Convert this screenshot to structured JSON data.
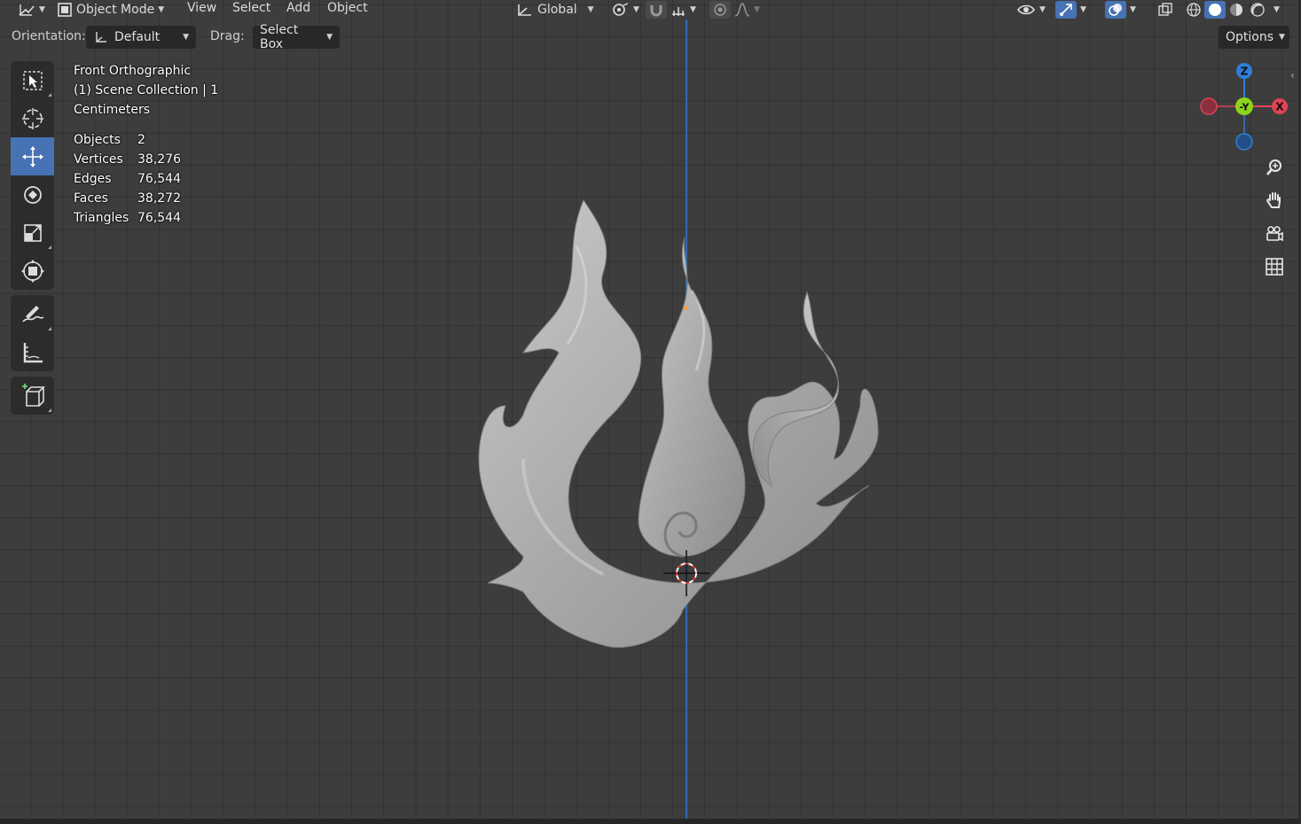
{
  "header": {
    "editor_type_icon": "editor-type-icon",
    "mode_label": "Object Mode",
    "menus": [
      "View",
      "Select",
      "Add",
      "Object"
    ],
    "transform_orientation": "Global",
    "colors": {
      "accent": "#4772b3",
      "background": "#3d3d3d",
      "header": "#303030"
    }
  },
  "tool_settings": {
    "orientation_label": "Orientation:",
    "orientation_value": "Default",
    "drag_label": "Drag:",
    "drag_value": "Select Box",
    "options_label": "Options"
  },
  "toolbar": {
    "tools": [
      {
        "name": "select-box-tool",
        "active": false
      },
      {
        "name": "cursor-tool",
        "active": false
      },
      {
        "name": "move-tool",
        "active": true
      },
      {
        "name": "rotate-tool",
        "active": false
      },
      {
        "name": "scale-tool",
        "active": false
      },
      {
        "name": "transform-tool",
        "active": false
      },
      {
        "name": "annotate-tool",
        "active": false
      },
      {
        "name": "measure-tool",
        "active": false
      },
      {
        "name": "add-cube-tool",
        "active": false
      }
    ]
  },
  "overlay": {
    "view_name": "Front Orthographic",
    "collection": "(1) Scene Collection | 1",
    "units": "Centimeters"
  },
  "stats": [
    {
      "label": "Objects",
      "value": "2"
    },
    {
      "label": "Vertices",
      "value": "38,276"
    },
    {
      "label": "Edges",
      "value": "76,544"
    },
    {
      "label": "Faces",
      "value": "38,272"
    },
    {
      "label": "Triangles",
      "value": "76,544"
    }
  ],
  "gizmo": {
    "z_label": "Z",
    "y_label": "-Y",
    "x_label": "X",
    "colors": {
      "x": "#e04256",
      "y": "#8bd51a",
      "z": "#2f7fd8"
    }
  },
  "nav_buttons": [
    "zoom-icon",
    "pan-hand-icon",
    "camera-icon",
    "grid-icon"
  ]
}
